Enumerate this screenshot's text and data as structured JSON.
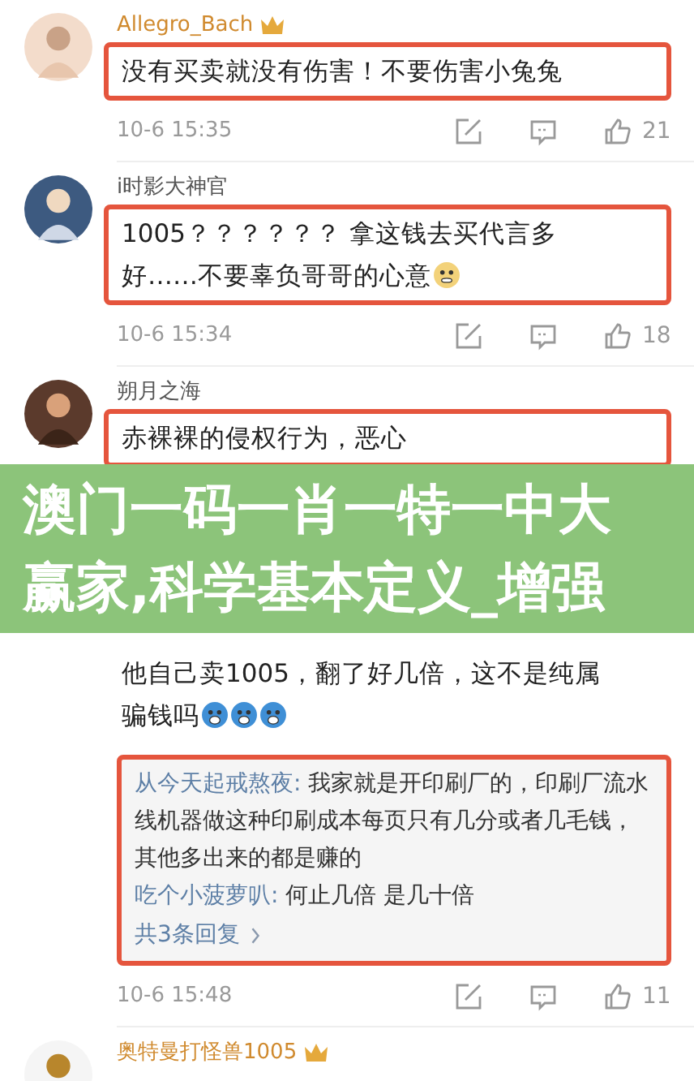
{
  "comments": [
    {
      "name": "Allegro_Bach",
      "vip": true,
      "paragraphs": [
        {
          "lines": [
            "没有买卖就没有伤害！不要伤害小兔兔"
          ],
          "boxed": true
        }
      ],
      "time": "10-6 15:35",
      "likes": "21"
    },
    {
      "name": "i时影大神官",
      "vip": false,
      "paragraphs": [
        {
          "lines": [
            "1005？？？？？？ 拿这钱去买代言多",
            "好……不要辜负哥哥的心意"
          ],
          "boxed": true
        }
      ],
      "emojis": [
        {
          "kind": "grin"
        }
      ],
      "time": "10-6 15:34",
      "likes": "18"
    },
    {
      "name": "朔月之海",
      "vip": false,
      "paragraphs": [
        {
          "lines": [
            "赤裸裸的侵权行为，恶心"
          ],
          "boxed": true
        }
      ]
    },
    {
      "paragraphs": [
        {
          "lines": [
            "他自己卖1005，翻了好几倍，这不是纯属",
            "骗钱吗"
          ],
          "boxed": false
        }
      ],
      "emojis": [
        {
          "kind": "shock"
        },
        {
          "kind": "shock"
        },
        {
          "kind": "shock"
        }
      ],
      "replies": [
        {
          "author": "从今天起戒熬夜:",
          "text": "我家就是开印刷厂的，印刷厂流水线机器做这种印刷成本每页只有几分或者几毛钱，其他多出来的都是赚的"
        },
        {
          "author": "吃个小菠萝叭:",
          "text": "何止几倍 是几十倍"
        }
      ],
      "more": "共3条回复",
      "time": "10-6 15:48",
      "likes": "11"
    },
    {
      "name": "奥特曼打怪兽1005",
      "vip": true
    }
  ],
  "banner": {
    "lines": [
      "澳门一码一肖一特一中大",
      "赢家,科学基本定义_增强"
    ]
  }
}
